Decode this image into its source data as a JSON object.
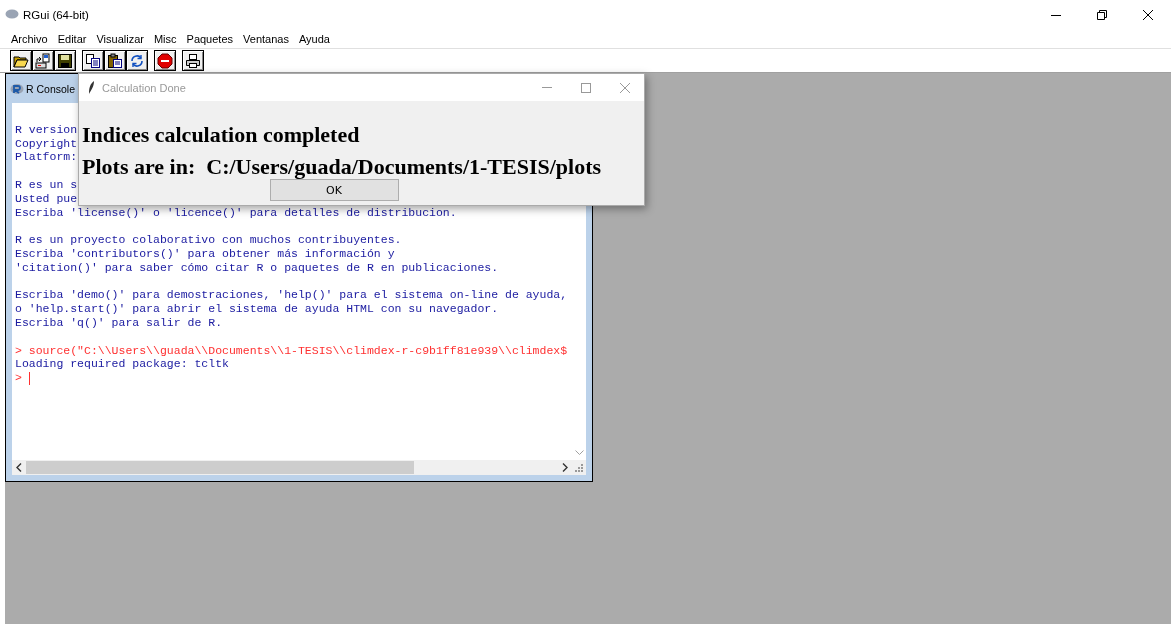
{
  "window": {
    "title": "RGui (64-bit)"
  },
  "menu": [
    "Archivo",
    "Editar",
    "Visualizar",
    "Misc",
    "Paquetes",
    "Ventanas",
    "Ayuda"
  ],
  "toolbar": [
    {
      "kind": "open"
    },
    {
      "kind": "load"
    },
    {
      "kind": "save"
    },
    {
      "kind": "copy"
    },
    {
      "kind": "paste"
    },
    {
      "kind": "copypaste"
    },
    {
      "kind": "stop"
    },
    {
      "kind": "print"
    }
  ],
  "console": {
    "title": "R Console",
    "lines": [
      {
        "kind": "blank"
      },
      {
        "kind": "output",
        "text": "R version"
      },
      {
        "kind": "output",
        "text": "Copyright"
      },
      {
        "kind": "output",
        "text": "Platform:"
      },
      {
        "kind": "blank"
      },
      {
        "kind": "output",
        "text": "R es un s"
      },
      {
        "kind": "output",
        "text": "Usted pue"
      },
      {
        "kind": "output",
        "text": "Escriba 'license()' o 'licence()' para detalles de distribucion."
      },
      {
        "kind": "blank"
      },
      {
        "kind": "output",
        "text": "R es un proyecto colaborativo con muchos contribuyentes."
      },
      {
        "kind": "output",
        "text": "Escriba 'contributors()' para obtener más información y"
      },
      {
        "kind": "output",
        "text": "'citation()' para saber cómo citar R o paquetes de R en publicaciones."
      },
      {
        "kind": "blank"
      },
      {
        "kind": "output",
        "text": "Escriba 'demo()' para demostraciones, 'help()' para el sistema on-line de ayuda,"
      },
      {
        "kind": "output",
        "text": "o 'help.start()' para abrir el sistema de ayuda HTML con su navegador."
      },
      {
        "kind": "output",
        "text": "Escriba 'q()' para salir de R."
      },
      {
        "kind": "blank"
      },
      {
        "kind": "input",
        "text": "> source(\"C:\\\\Users\\\\guada\\\\Documents\\\\1-TESIS\\\\climdex-r-c9b1ff81e939\\\\climdex$"
      },
      {
        "kind": "output",
        "text": "Loading required package: tcltk"
      },
      {
        "kind": "prompt",
        "text": ">"
      }
    ]
  },
  "dialog": {
    "title": "Calculation Done",
    "messages": [
      "Indices calculation completed",
      "Plots are in:  C:/Users/guada/Documents/1-TESIS/plots"
    ],
    "button": "OK"
  }
}
